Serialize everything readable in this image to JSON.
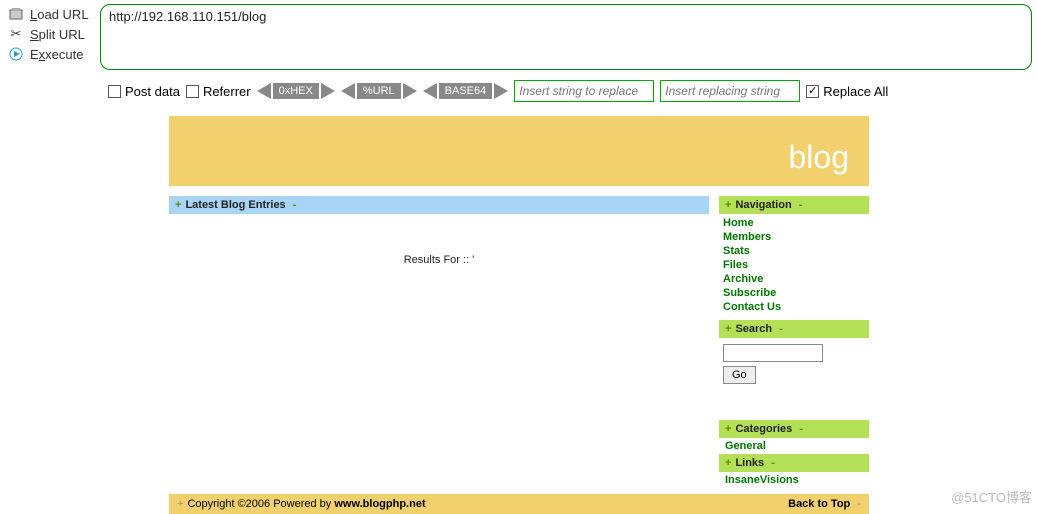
{
  "menu": {
    "load": "oad URL",
    "split": "plit URL",
    "execute": "xecute"
  },
  "url": "http://192.168.110.151/blog",
  "toolbar": {
    "postdata": "Post data",
    "referrer": "Referrer",
    "hex": "0xHEX",
    "urlenc": "%URL",
    "base64": "BASE64",
    "replace_from_ph": "Insert string to replace",
    "replace_to_ph": "Insert replacing string",
    "replace_all": "Replace All"
  },
  "banner": {
    "title": "blog"
  },
  "main": {
    "latest_header": "Latest Blog Entries",
    "results": "Results For :: '"
  },
  "side": {
    "nav_header": "Navigation",
    "nav": [
      "Home",
      "Members",
      "Stats",
      "Files",
      "Archive",
      "Subscribe",
      "Contact Us"
    ],
    "search_header": "Search",
    "go": "Go",
    "cat_header": "Categories",
    "cat": "General",
    "links_header": "Links",
    "link": "InsaneVisions"
  },
  "footer": {
    "copy_pre": "Copyright ©2006 Powered by ",
    "copy_bold": "www.blogphp.net",
    "backtop": "Back to Top"
  },
  "watermark": "@51CTO博客"
}
